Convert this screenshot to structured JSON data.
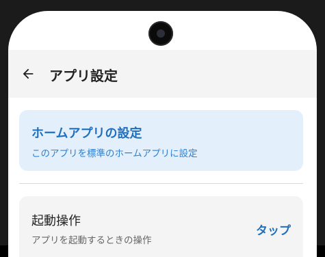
{
  "app_bar": {
    "title": "アプリ設定",
    "back_icon": "arrow-back-icon"
  },
  "home_app_card": {
    "title": "ホームアプリの設定",
    "subtitle": "このアプリを標準のホームアプリに設定"
  },
  "launch_action": {
    "title": "起動操作",
    "subtitle": "アプリを起動するときの操作",
    "value": "タップ"
  },
  "colors": {
    "accent": "#1f6fbf",
    "card_highlight": "#e3f0fc",
    "app_bar_bg": "#f4f4f4"
  }
}
